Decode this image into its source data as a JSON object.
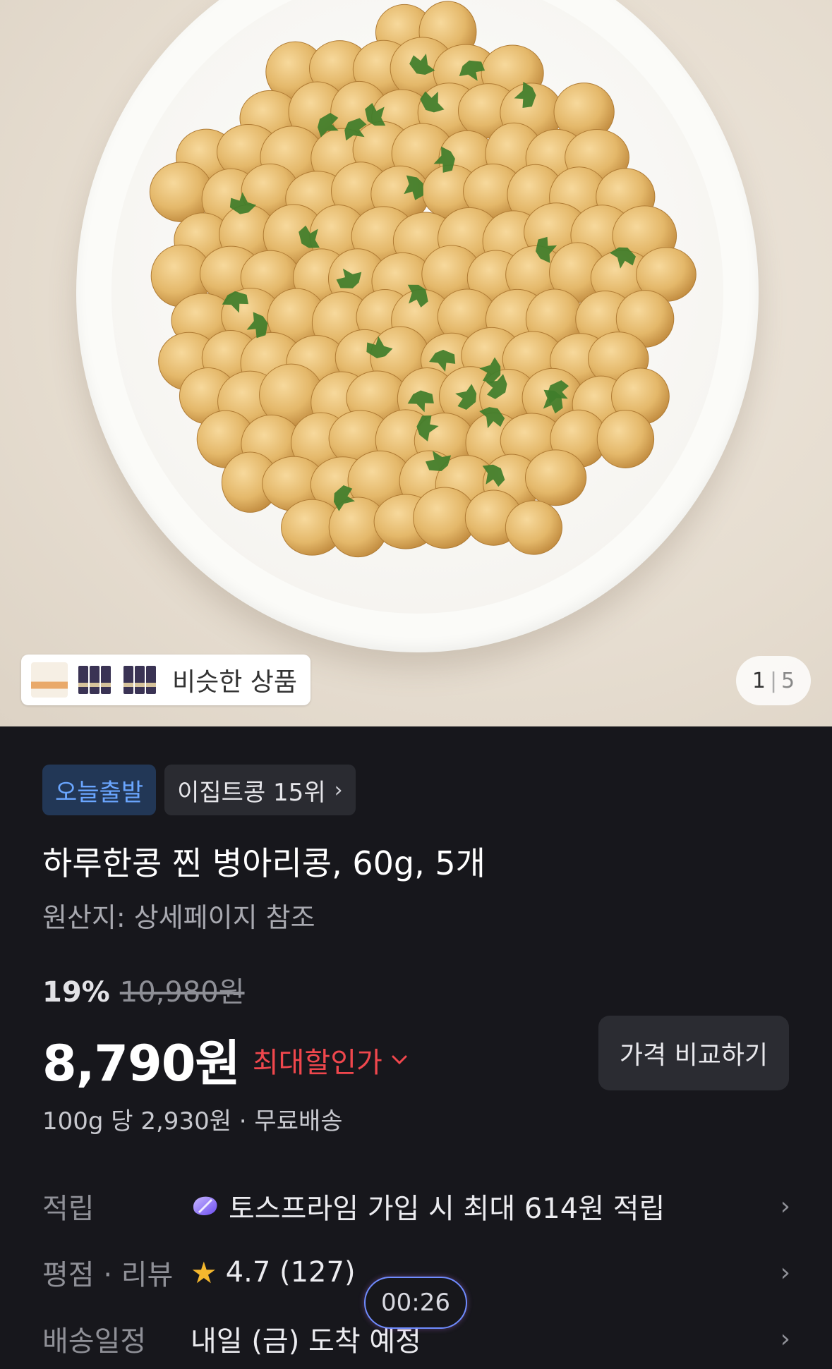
{
  "gallery": {
    "similar_label": "비슷한 상품",
    "counter_current": "1",
    "counter_separator": "|",
    "counter_total": "5"
  },
  "tags": {
    "departure": "오늘출발",
    "ranking": "이집트콩 15위"
  },
  "product": {
    "title": "하루한콩 찐 병아리콩, 60g, 5개",
    "origin": "원산지: 상세페이지 참조"
  },
  "pricing": {
    "discount_percent": "19%",
    "original_price": "10,980원",
    "price": "8,790원",
    "max_discount_label": "최대할인가",
    "compare_button": "가격 비교하기",
    "unit_info": "100g 당 2,930원 · 무료배송"
  },
  "info_rows": {
    "points_label": "적립",
    "points_value": "토스프라임 가입 시 최대 614원 적립",
    "rating_label": "평점 · 리뷰",
    "rating_value": "4.7 (127)",
    "delivery_label": "배송일정",
    "delivery_value": "내일 (금) 도착 예정"
  },
  "overlay": {
    "timer": "00:26"
  },
  "colors": {
    "background": "#17171c",
    "accent_red": "#f0474d",
    "tag_blue": "#6aa6ff",
    "star": "#f5b82e"
  }
}
